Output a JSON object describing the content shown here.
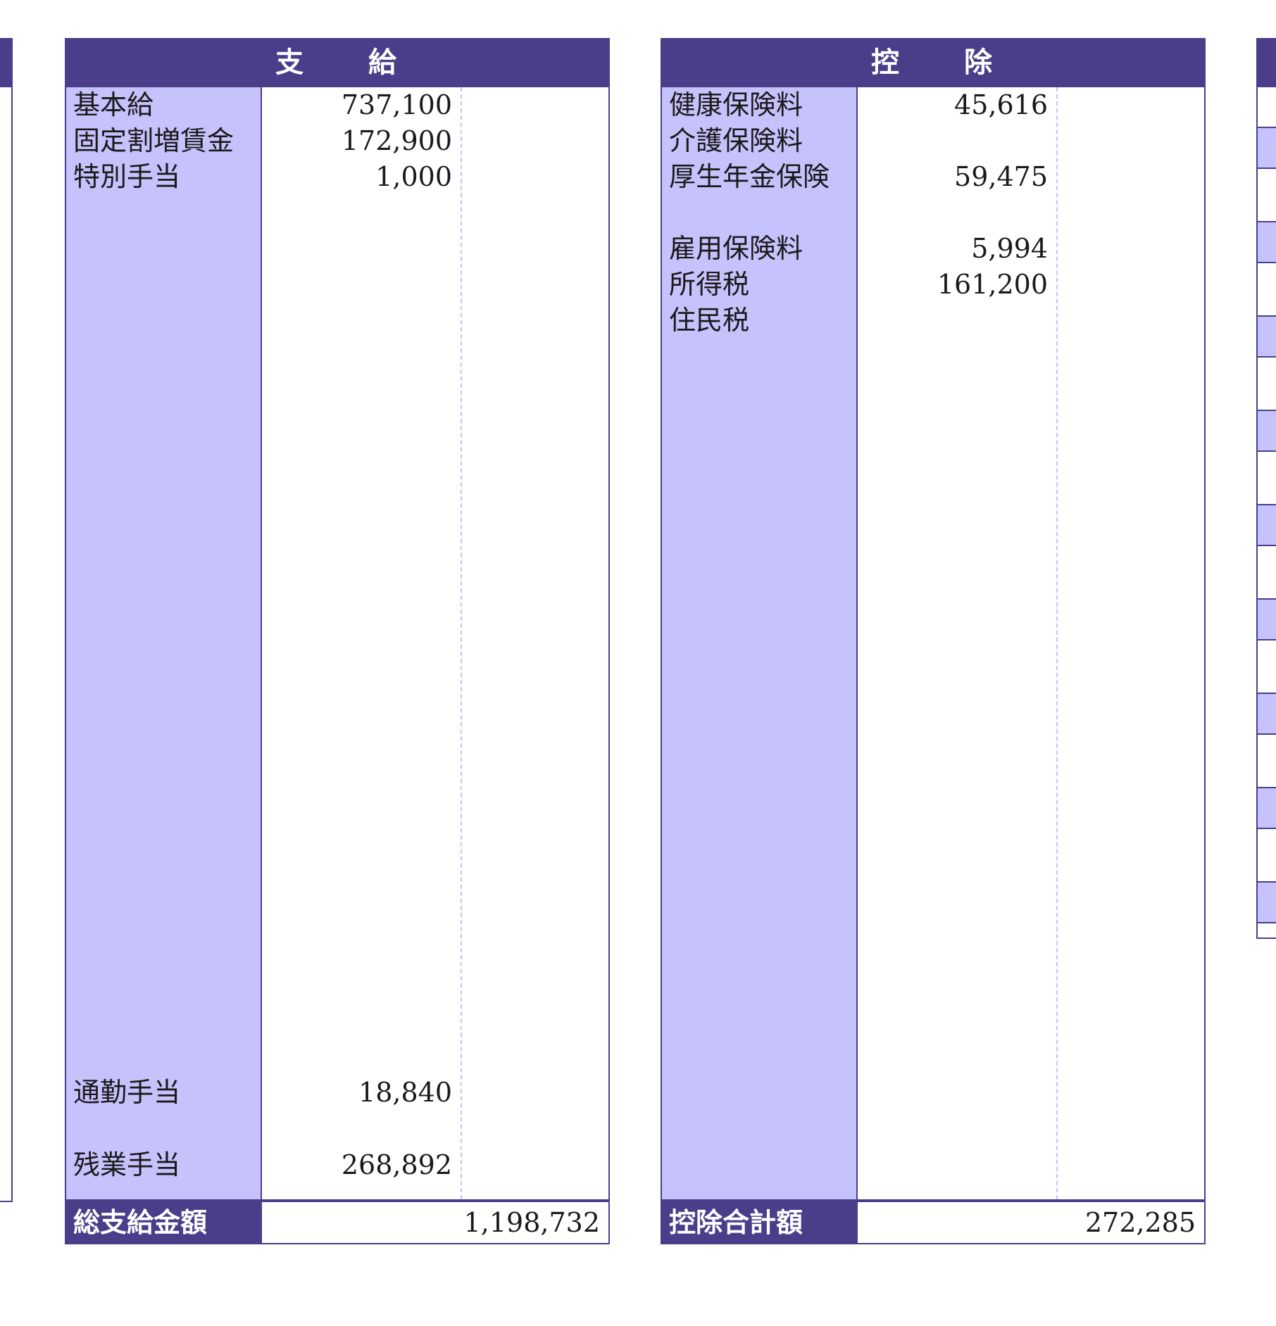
{
  "payments": {
    "header": "支　　給",
    "items": [
      {
        "label": "基本給",
        "value": "737,100"
      },
      {
        "label": "固定割増賃金",
        "value": "172,900"
      },
      {
        "label": "特別手当",
        "value": "1,000"
      },
      {
        "label": "通勤手当",
        "value": "18,840"
      },
      {
        "label": "残業手当",
        "value": "268,892"
      }
    ],
    "total_label": "総支給金額",
    "total_value": "1,198,732"
  },
  "deductions": {
    "header": "控　　除",
    "items": [
      {
        "label": "健康保険料",
        "value": "45,616"
      },
      {
        "label": "介護保険料",
        "value": ""
      },
      {
        "label": "厚生年金保険",
        "value": "59,475"
      },
      {
        "label": "雇用保険料",
        "value": "5,994"
      },
      {
        "label": "所得税",
        "value": "161,200"
      },
      {
        "label": "住民税",
        "value": ""
      }
    ],
    "total_label": "控除合計額",
    "total_value": "272,285"
  },
  "colors": {
    "header": "#4a3e8a",
    "label_column": "#c5c2fc",
    "text": "#1a1a1a"
  }
}
